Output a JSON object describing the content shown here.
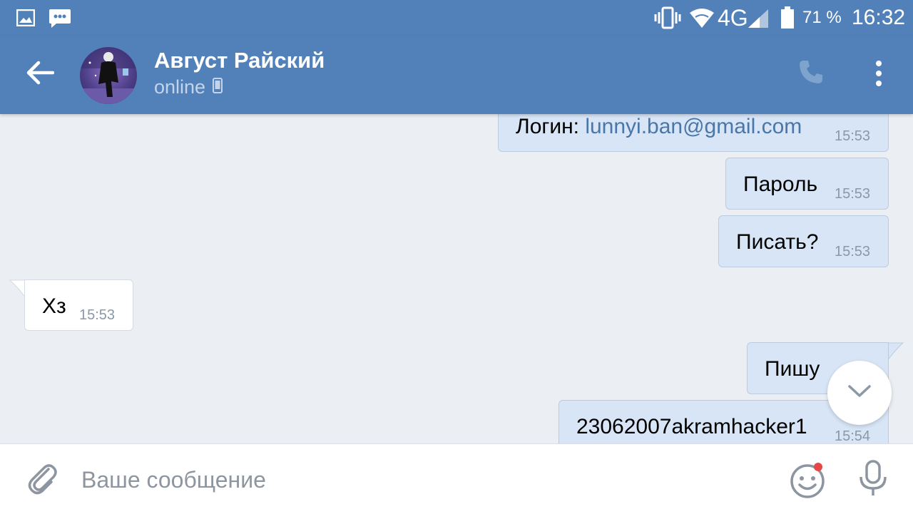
{
  "status_bar": {
    "network": "4G",
    "battery": "71 %",
    "time": "16:32"
  },
  "header": {
    "contact_name": "Август Райский",
    "status": "online",
    "back_icon": "arrow-left-icon",
    "call_icon": "phone-icon",
    "menu_icon": "more-vertical-icon"
  },
  "messages": [
    {
      "direction": "out",
      "label": "Логин: ",
      "link": "lunnyi.ban@gmail.com",
      "time": "15:53"
    },
    {
      "direction": "out",
      "text": "Пароль",
      "time": "15:53"
    },
    {
      "direction": "out",
      "text": "Писать?",
      "time": "15:53"
    },
    {
      "direction": "in",
      "text": "Хз",
      "time": "15:53"
    },
    {
      "direction": "out",
      "text": "Пишу",
      "time": ""
    },
    {
      "direction": "out",
      "text": "23062007akramhacker1",
      "time": "15:54"
    }
  ],
  "composer": {
    "placeholder": "Ваше сообщение",
    "value": ""
  },
  "colors": {
    "header_bg": "#5181b8",
    "chat_bg": "#ebeff4",
    "outgoing_bubble": "#d7e5f6",
    "incoming_bubble": "#ffffff",
    "link": "#4a76a8",
    "notification_dot": "#e64646"
  }
}
